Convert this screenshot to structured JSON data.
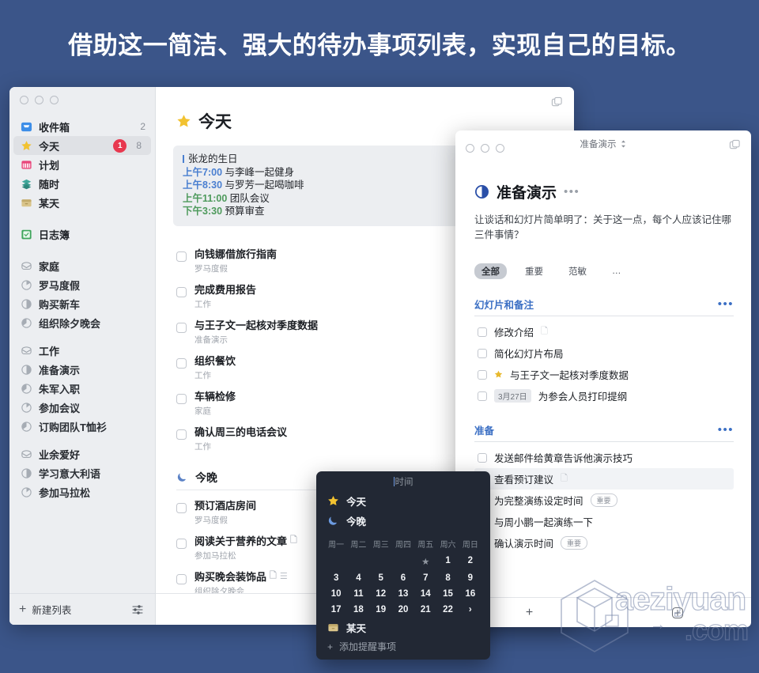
{
  "headline": "借助这一简洁、强大的待办事项列表，实现自己的目标。",
  "colors": {
    "background": "#3b5589",
    "accent_blue": "#3b6fc4",
    "badge_red": "#e8384f",
    "star_yellow": "#f2c230",
    "moon_blue": "#5b82c6",
    "event_green": "#4e9a5c",
    "popup_dark": "#222834"
  },
  "main_window": {
    "duplicate_icon": "duplicate-icon",
    "sidebar": {
      "groups": [
        {
          "items": [
            {
              "icon": "inbox-icon",
              "label": "收件箱",
              "count": "2",
              "badge": "",
              "selected": false
            },
            {
              "icon": "star-icon",
              "label": "今天",
              "count": "8",
              "badge": "1",
              "selected": true
            },
            {
              "icon": "calendar-icon",
              "label": "计划",
              "count": "",
              "badge": "",
              "selected": false
            },
            {
              "icon": "layers-icon",
              "label": "随时",
              "count": "",
              "badge": "",
              "selected": false
            },
            {
              "icon": "box-icon",
              "label": "某天",
              "count": "",
              "badge": "",
              "selected": false
            }
          ]
        },
        {
          "items": [
            {
              "icon": "logbook-icon",
              "label": "日志簿",
              "count": "",
              "badge": "",
              "selected": false
            }
          ]
        },
        {
          "items": [
            {
              "icon": "area-icon",
              "label": "家庭",
              "kind": "area"
            },
            {
              "icon": "progress-icon",
              "label": "罗马度假",
              "kind": "project"
            },
            {
              "icon": "progress-icon",
              "label": "购买新车",
              "kind": "project"
            },
            {
              "icon": "progress-icon",
              "label": "组织除夕晚会",
              "kind": "project"
            }
          ]
        },
        {
          "items": [
            {
              "icon": "area-icon",
              "label": "工作",
              "kind": "area"
            },
            {
              "icon": "progress-icon",
              "label": "准备演示",
              "kind": "project"
            },
            {
              "icon": "progress-icon",
              "label": "朱军入职",
              "kind": "project"
            },
            {
              "icon": "progress-icon",
              "label": "参加会议",
              "kind": "project"
            },
            {
              "icon": "progress-icon",
              "label": "订购团队T恤衫",
              "kind": "project"
            }
          ]
        },
        {
          "items": [
            {
              "icon": "area-icon",
              "label": "业余爱好",
              "kind": "area"
            },
            {
              "icon": "progress-icon",
              "label": "学习意大利语",
              "kind": "project"
            },
            {
              "icon": "progress-icon",
              "label": "参加马拉松",
              "kind": "project"
            }
          ]
        }
      ],
      "footer": {
        "new_list_label": "新建列表",
        "new_list_icon": "plus-icon",
        "settings_icon": "sliders-icon"
      }
    },
    "content": {
      "title": "今天",
      "title_icon": "star-icon",
      "events": [
        {
          "time": "",
          "text": "张龙的生日",
          "color": "bar"
        },
        {
          "time": "上午7:00",
          "text": "与李峰一起健身",
          "color": "blue"
        },
        {
          "time": "上午8:30",
          "text": "与罗芳一起喝咖啡",
          "color": "blue"
        },
        {
          "time": "上午11:00",
          "text": "团队会议",
          "color": "green"
        },
        {
          "time": "下午3:30",
          "text": "预算审查",
          "color": "green"
        }
      ],
      "tasks": [
        {
          "title": "向钱娜借旅行指南",
          "sub": "罗马度假",
          "icons": ""
        },
        {
          "title": "完成费用报告",
          "sub": "工作",
          "icons": ""
        },
        {
          "title": "与王子文一起核对季度数据",
          "sub": "准备演示",
          "icons": ""
        },
        {
          "title": "组织餐饮",
          "sub": "工作",
          "icons": ""
        },
        {
          "title": "车辆检修",
          "sub": "家庭",
          "icons": ""
        },
        {
          "title": "确认周三的电话会议",
          "sub": "工作",
          "icons": ""
        }
      ],
      "tonight": {
        "label": "今晚",
        "icon": "moon-icon",
        "tasks": [
          {
            "title": "预订酒店房间",
            "sub": "罗马度假",
            "icons": ""
          },
          {
            "title": "阅读关于营养的文章",
            "sub": "参加马拉松",
            "icons": "note-icon"
          },
          {
            "title": "购买晚会装饰品",
            "sub": "组织除夕晚会",
            "icons": "note-icon checklist-icon"
          }
        ]
      },
      "footer_add_icon": "plus-icon"
    }
  },
  "detail_window": {
    "titlebar": {
      "title": "准备演示",
      "chevron_icon": "chevron-updown-icon",
      "duplicate_icon": "duplicate-icon"
    },
    "heading": {
      "icon": "progress-half-icon",
      "title": "准备演示",
      "more_icon": "more-icon"
    },
    "note": "让谈话和幻灯片简单明了：关于这一点，每个人应该记住哪三件事情？",
    "chips": [
      {
        "label": "全部",
        "active": true
      },
      {
        "label": "重要",
        "active": false
      },
      {
        "label": "范敏",
        "active": false
      },
      {
        "label": "…",
        "active": false
      }
    ],
    "sections": [
      {
        "title": "幻灯片和备注",
        "more_icon": "more-icon",
        "items": [
          {
            "text": "修改介绍",
            "star": false,
            "tag": "",
            "pill": "",
            "icons": "note-icon",
            "highlight": false
          },
          {
            "text": "简化幻灯片布局",
            "star": false,
            "tag": "",
            "pill": "",
            "icons": "",
            "highlight": false
          },
          {
            "text": "与王子文一起核对季度数据",
            "star": true,
            "tag": "",
            "pill": "",
            "icons": "",
            "highlight": false
          },
          {
            "text": "为参会人员打印提纲",
            "star": false,
            "tag": "3月27日",
            "pill": "",
            "icons": "",
            "highlight": false
          }
        ]
      },
      {
        "title": "准备",
        "more_icon": "more-icon",
        "items": [
          {
            "text": "发送邮件给黄章告诉他演示技巧",
            "star": false,
            "tag": "",
            "pill": "",
            "icons": "",
            "highlight": false
          },
          {
            "text": "查看预订建议",
            "star": false,
            "tag": "",
            "pill": "",
            "icons": "note-icon",
            "highlight": true
          },
          {
            "text": "为完整演练设定时间",
            "star": false,
            "tag": "",
            "pill": "重要",
            "icons": "",
            "highlight": false
          },
          {
            "text": "与周小鹏一起演练一下",
            "star": false,
            "tag": "",
            "pill": "",
            "icons": "",
            "highlight": false
          },
          {
            "text": "确认演示时间",
            "star": false,
            "tag": "",
            "pill": "重要",
            "icons": "",
            "highlight": false
          }
        ]
      }
    ],
    "footer": {
      "add_icon": "plus-icon",
      "add_circle_icon": "plus-circle-icon"
    }
  },
  "date_popup": {
    "search_placeholder": "时间",
    "quick": [
      {
        "icon": "star-icon",
        "label": "今天"
      },
      {
        "icon": "moon-icon",
        "label": "今晚"
      }
    ],
    "weekdays": [
      "周一",
      "周二",
      "周三",
      "周四",
      "周五",
      "周六",
      "周日"
    ],
    "rows": [
      [
        "",
        "",
        "",
        "",
        "★",
        "1",
        "2"
      ],
      [
        "3",
        "4",
        "5",
        "6",
        "7",
        "8",
        "9"
      ],
      [
        "10",
        "11",
        "12",
        "13",
        "14",
        "15",
        "16"
      ],
      [
        "17",
        "18",
        "19",
        "20",
        "21",
        "22",
        "›"
      ]
    ],
    "someday": {
      "icon": "box-icon",
      "label": "某天"
    },
    "add_reminder": {
      "icon": "plus-icon",
      "label": "添加提醒事项"
    }
  },
  "watermark": {
    "line1": "aeziyuan",
    "line2": ".com"
  }
}
